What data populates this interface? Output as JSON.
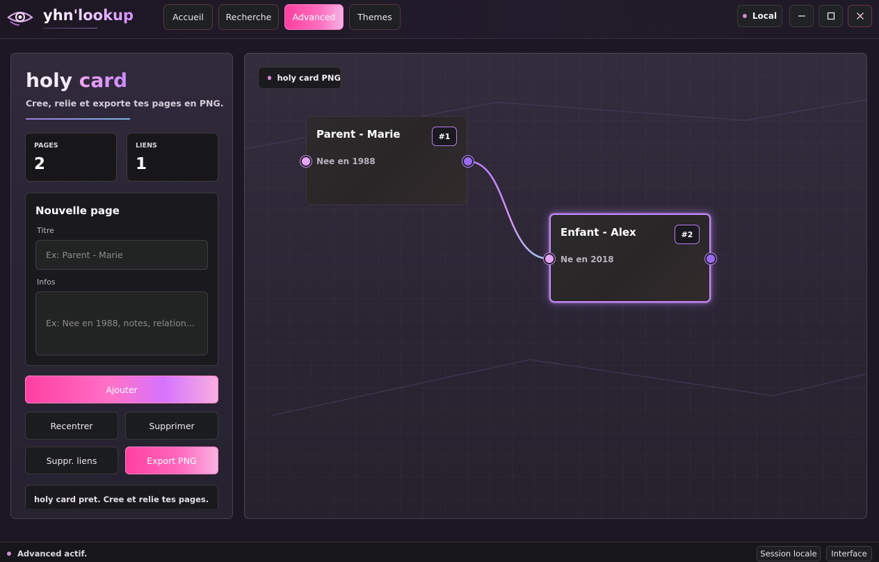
{
  "app": {
    "name": "yhn'lookup",
    "logo_icon": "eye-logo-icon"
  },
  "nav": {
    "items": [
      {
        "label": "Accueil",
        "active": false
      },
      {
        "label": "Recherche",
        "active": false
      },
      {
        "label": "Advanced",
        "active": true
      },
      {
        "label": "Themes",
        "active": false
      }
    ]
  },
  "window": {
    "mode_label": "Local",
    "minimize_icon": "minimize-icon",
    "maximize_icon": "maximize-icon",
    "close_icon": "close-icon"
  },
  "sidebar": {
    "title_part1": "holy",
    "title_part2": "card",
    "subtitle": "Cree, relie et exporte tes pages en PNG.",
    "stats": [
      {
        "label": "PAGES",
        "value": "2"
      },
      {
        "label": "LIENS",
        "value": "1"
      }
    ],
    "form": {
      "title": "Nouvelle page",
      "title_label": "Titre",
      "title_placeholder": "Ex: Parent - Marie",
      "title_value": "",
      "infos_label": "Infos",
      "infos_placeholder": "Ex: Nee en 1988, notes, relation...",
      "infos_value": ""
    },
    "buttons": {
      "add": "Ajouter",
      "recenter": "Recentrer",
      "delete": "Supprimer",
      "delete_links": "Suppr. liens",
      "export": "Export PNG"
    },
    "status_text": "holy card pret. Cree et relie tes pages."
  },
  "canvas": {
    "tag_label": "holy card PNG",
    "nodes": [
      {
        "title": "Parent - Marie",
        "badge": "#1",
        "info": "Nee en 1988",
        "selected": false
      },
      {
        "title": "Enfant - Alex",
        "badge": "#2",
        "info": "Ne en 2018",
        "selected": true
      }
    ],
    "colors": {
      "accent_pink": "#ff3fa0",
      "accent_purple": "#c78bff",
      "port_in": "#e4a6f3",
      "port_out": "#9b6cf2"
    }
  },
  "footer": {
    "status": "Advanced actif.",
    "session_label": "Session locale",
    "interface_label": "Interface"
  }
}
